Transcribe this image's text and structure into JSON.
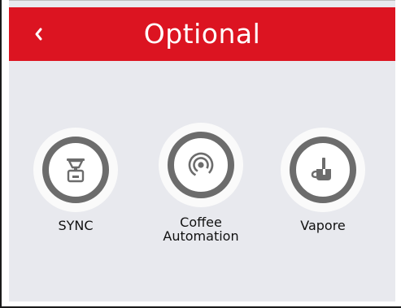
{
  "header": {
    "title": "Optional",
    "back_icon": "chevron-left-icon",
    "background": "#dc1421"
  },
  "options": [
    {
      "label": "SYNC",
      "icon": "scale-icon"
    },
    {
      "label": "Coffee\nAutomation",
      "icon": "wireless-signal-icon"
    },
    {
      "label": "Vapore",
      "icon": "steam-cup-icon"
    }
  ],
  "colors": {
    "screen_bg": "#e8e9ee",
    "icon_ring": "#6c6c6c"
  }
}
